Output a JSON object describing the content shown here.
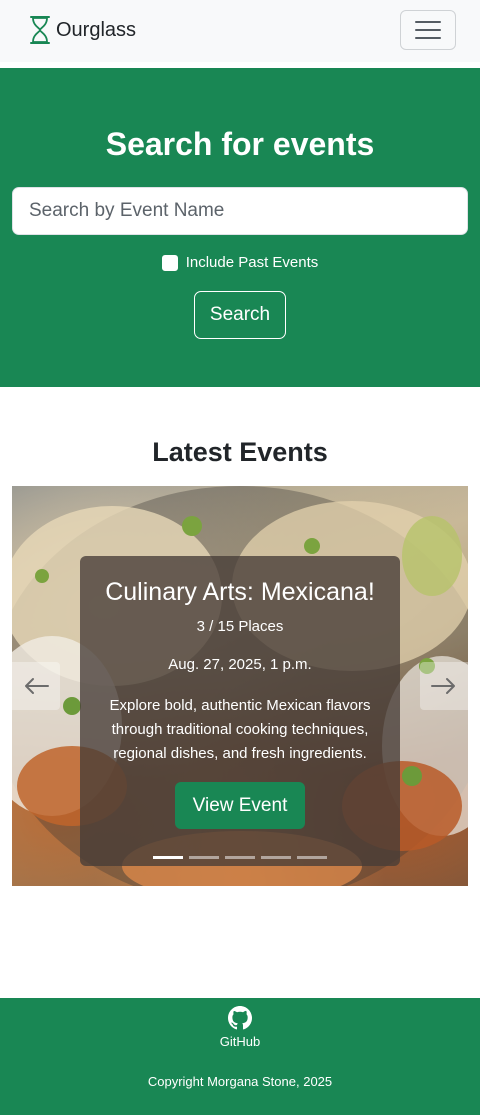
{
  "navbar": {
    "brand_name": "Ourglass",
    "logo_icon": "hourglass-icon",
    "menu_icon": "hamburger-menu-icon"
  },
  "hero": {
    "title": "Search for events",
    "search_placeholder": "Search by Event Name",
    "search_value": "",
    "checkbox_label": "Include Past Events",
    "checkbox_checked": false,
    "search_button": "Search",
    "background_color": "#198754"
  },
  "latest": {
    "title": "Latest Events",
    "slide": {
      "event_title": "Culinary Arts: Mexicana!",
      "places": "3 / 15 Places",
      "date": "Aug. 27, 2025, 1 p.m.",
      "description": "Explore bold, authentic Mexican flavors through traditional cooking techniques, regional dishes, and fresh ingredients.",
      "button_label": "View Event"
    },
    "active_slide": 1,
    "slide_count": 5,
    "prev_icon": "arrow-left-icon",
    "next_icon": "arrow-right-icon"
  },
  "footer": {
    "github_icon": "github-icon",
    "github_label": "GitHub",
    "copyright": "Copyright Morgana Stone, 2025"
  }
}
